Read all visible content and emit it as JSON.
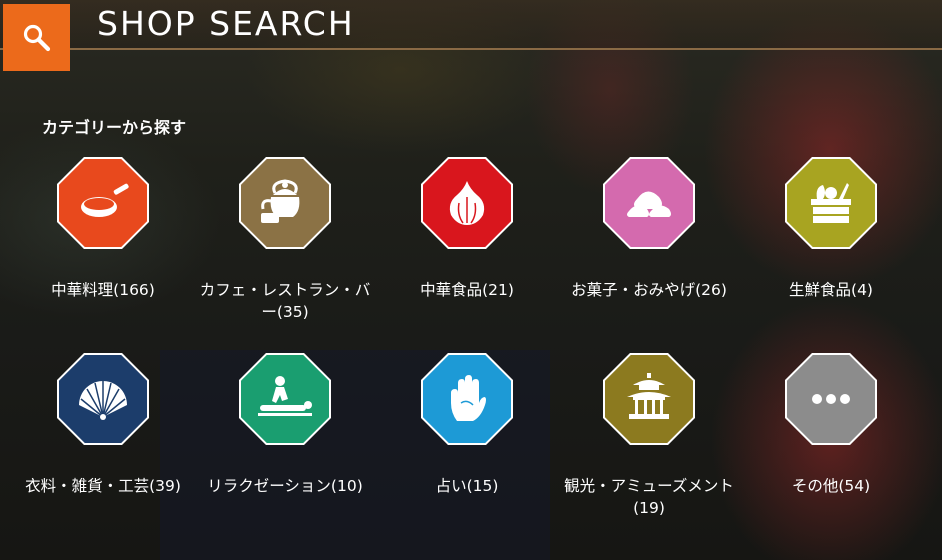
{
  "header": {
    "title": "SHOP SEARCH",
    "search_icon": "search-icon"
  },
  "section_label": "カテゴリーから探す",
  "categories": [
    {
      "label": "中華料理(166)",
      "color": "#e8491d",
      "icon": "wok-icon"
    },
    {
      "label": "カフェ・レストラン・バー(35)",
      "color": "#8b7245",
      "icon": "teapot-icon"
    },
    {
      "label": "中華食品(21)",
      "color": "#d9161d",
      "icon": "garlic-icon"
    },
    {
      "label": "お菓子・おみやげ(26)",
      "color": "#d46aae",
      "icon": "buns-icon"
    },
    {
      "label": "生鮮食品(4)",
      "color": "#a8a421",
      "icon": "vegetable-basket-icon"
    },
    {
      "label": "衣料・雑貨・工芸(39)",
      "color": "#1c3d6b",
      "icon": "folding-fan-icon"
    },
    {
      "label": "リラクゼーション(10)",
      "color": "#1a9e70",
      "icon": "massage-icon"
    },
    {
      "label": "占い(15)",
      "color": "#1d9ad6",
      "icon": "palm-hand-icon"
    },
    {
      "label": "観光・アミューズメント(19)",
      "color": "#8c7a1f",
      "icon": "pavilion-icon"
    },
    {
      "label": "その他(54)",
      "color": "#8c8c8c",
      "icon": "more-dots-icon"
    }
  ]
}
